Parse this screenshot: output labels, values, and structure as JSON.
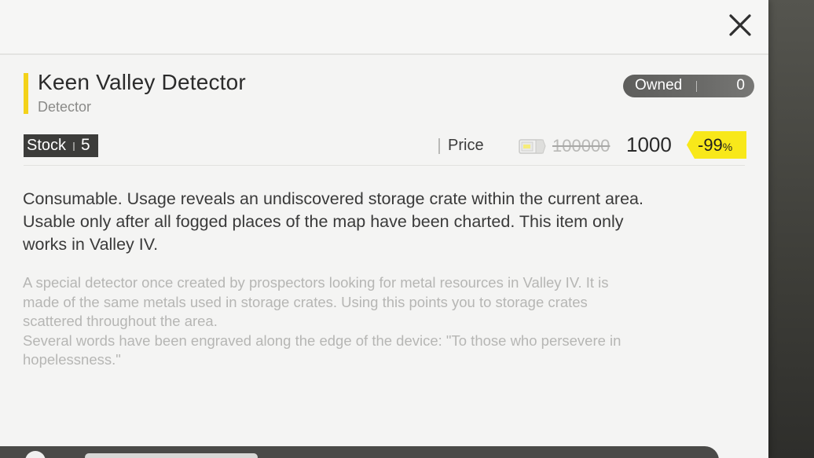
{
  "item": {
    "name": "Keen Valley Detector",
    "type": "Detector",
    "accent_color": "#f3d21a"
  },
  "owned": {
    "label": "Owned",
    "count": "0"
  },
  "stock": {
    "label": "Stock",
    "value": "5"
  },
  "price": {
    "label": "Price",
    "currency_icon": "currency-ticket-icon",
    "original": "100000",
    "current": "1000",
    "discount_value": "-99",
    "discount_unit": "%",
    "discount_color": "#f8e81a"
  },
  "description": {
    "lines": [
      "Consumable. Usage reveals an undiscovered storage crate within the current area.",
      "Usable only after all fogged places of the map have been charted. This item only",
      "works in Valley IV."
    ]
  },
  "flavor": {
    "lines": [
      "A special detector once created by prospectors looking for metal resources in Valley IV. It is",
      "made of the same metals used in storage crates. Using this points you to storage crates",
      "scattered throughout the area.",
      "Several words have been engraved along the edge of the device: \"To those who persevere in",
      "hopelessness.\""
    ]
  },
  "icons": {
    "close": "close-icon"
  }
}
